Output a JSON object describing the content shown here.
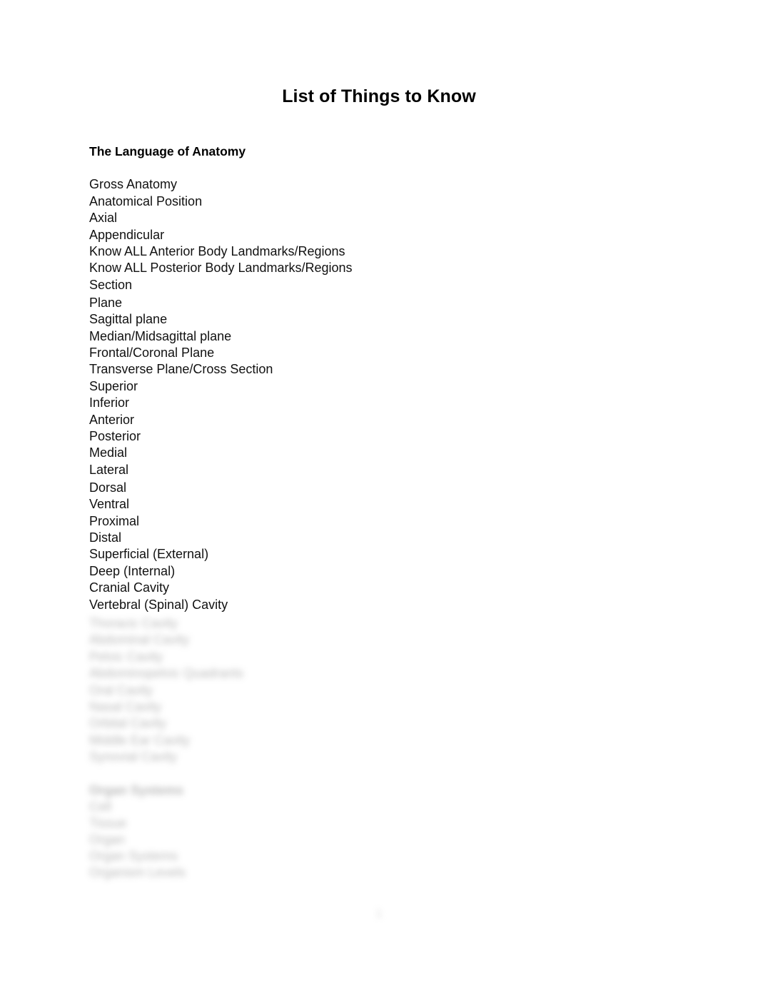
{
  "document": {
    "title": "List of Things to Know",
    "page_number": "1"
  },
  "sections": [
    {
      "heading": "The Language of Anatomy",
      "items": [
        "Gross Anatomy",
        "Anatomical Position",
        "Axial",
        "Appendicular",
        "Know ALL Anterior Body Landmarks/Regions",
        "Know ALL Posterior Body Landmarks/Regions",
        "Section",
        "Plane",
        "Sagittal plane",
        "Median/Midsagittal plane",
        "Frontal/Coronal Plane",
        "Transverse Plane/Cross Section",
        "Superior",
        "Inferior",
        "Anterior",
        "Posterior",
        "Medial",
        "Lateral",
        "Dorsal",
        "Ventral",
        "Proximal",
        "Distal",
        "Superficial (External)",
        "Deep (Internal)",
        "Cranial Cavity",
        "Vertebral (Spinal) Cavity"
      ]
    }
  ],
  "redacted": {
    "note": "illegible blurred text",
    "block_a": [
      "Thoracic Cavity",
      "Abdominal Cavity",
      "Pelvic Cavity",
      "Abdominopelvic Quadrants",
      "Oral Cavity",
      "Nasal Cavity",
      "Orbital Cavity",
      "Middle Ear Cavity",
      "Synovial Cavity"
    ],
    "block_b": [
      "Organ Systems",
      "Cell",
      "Tissue",
      "Organ",
      "Organ Systems",
      "Organism Levels"
    ]
  }
}
